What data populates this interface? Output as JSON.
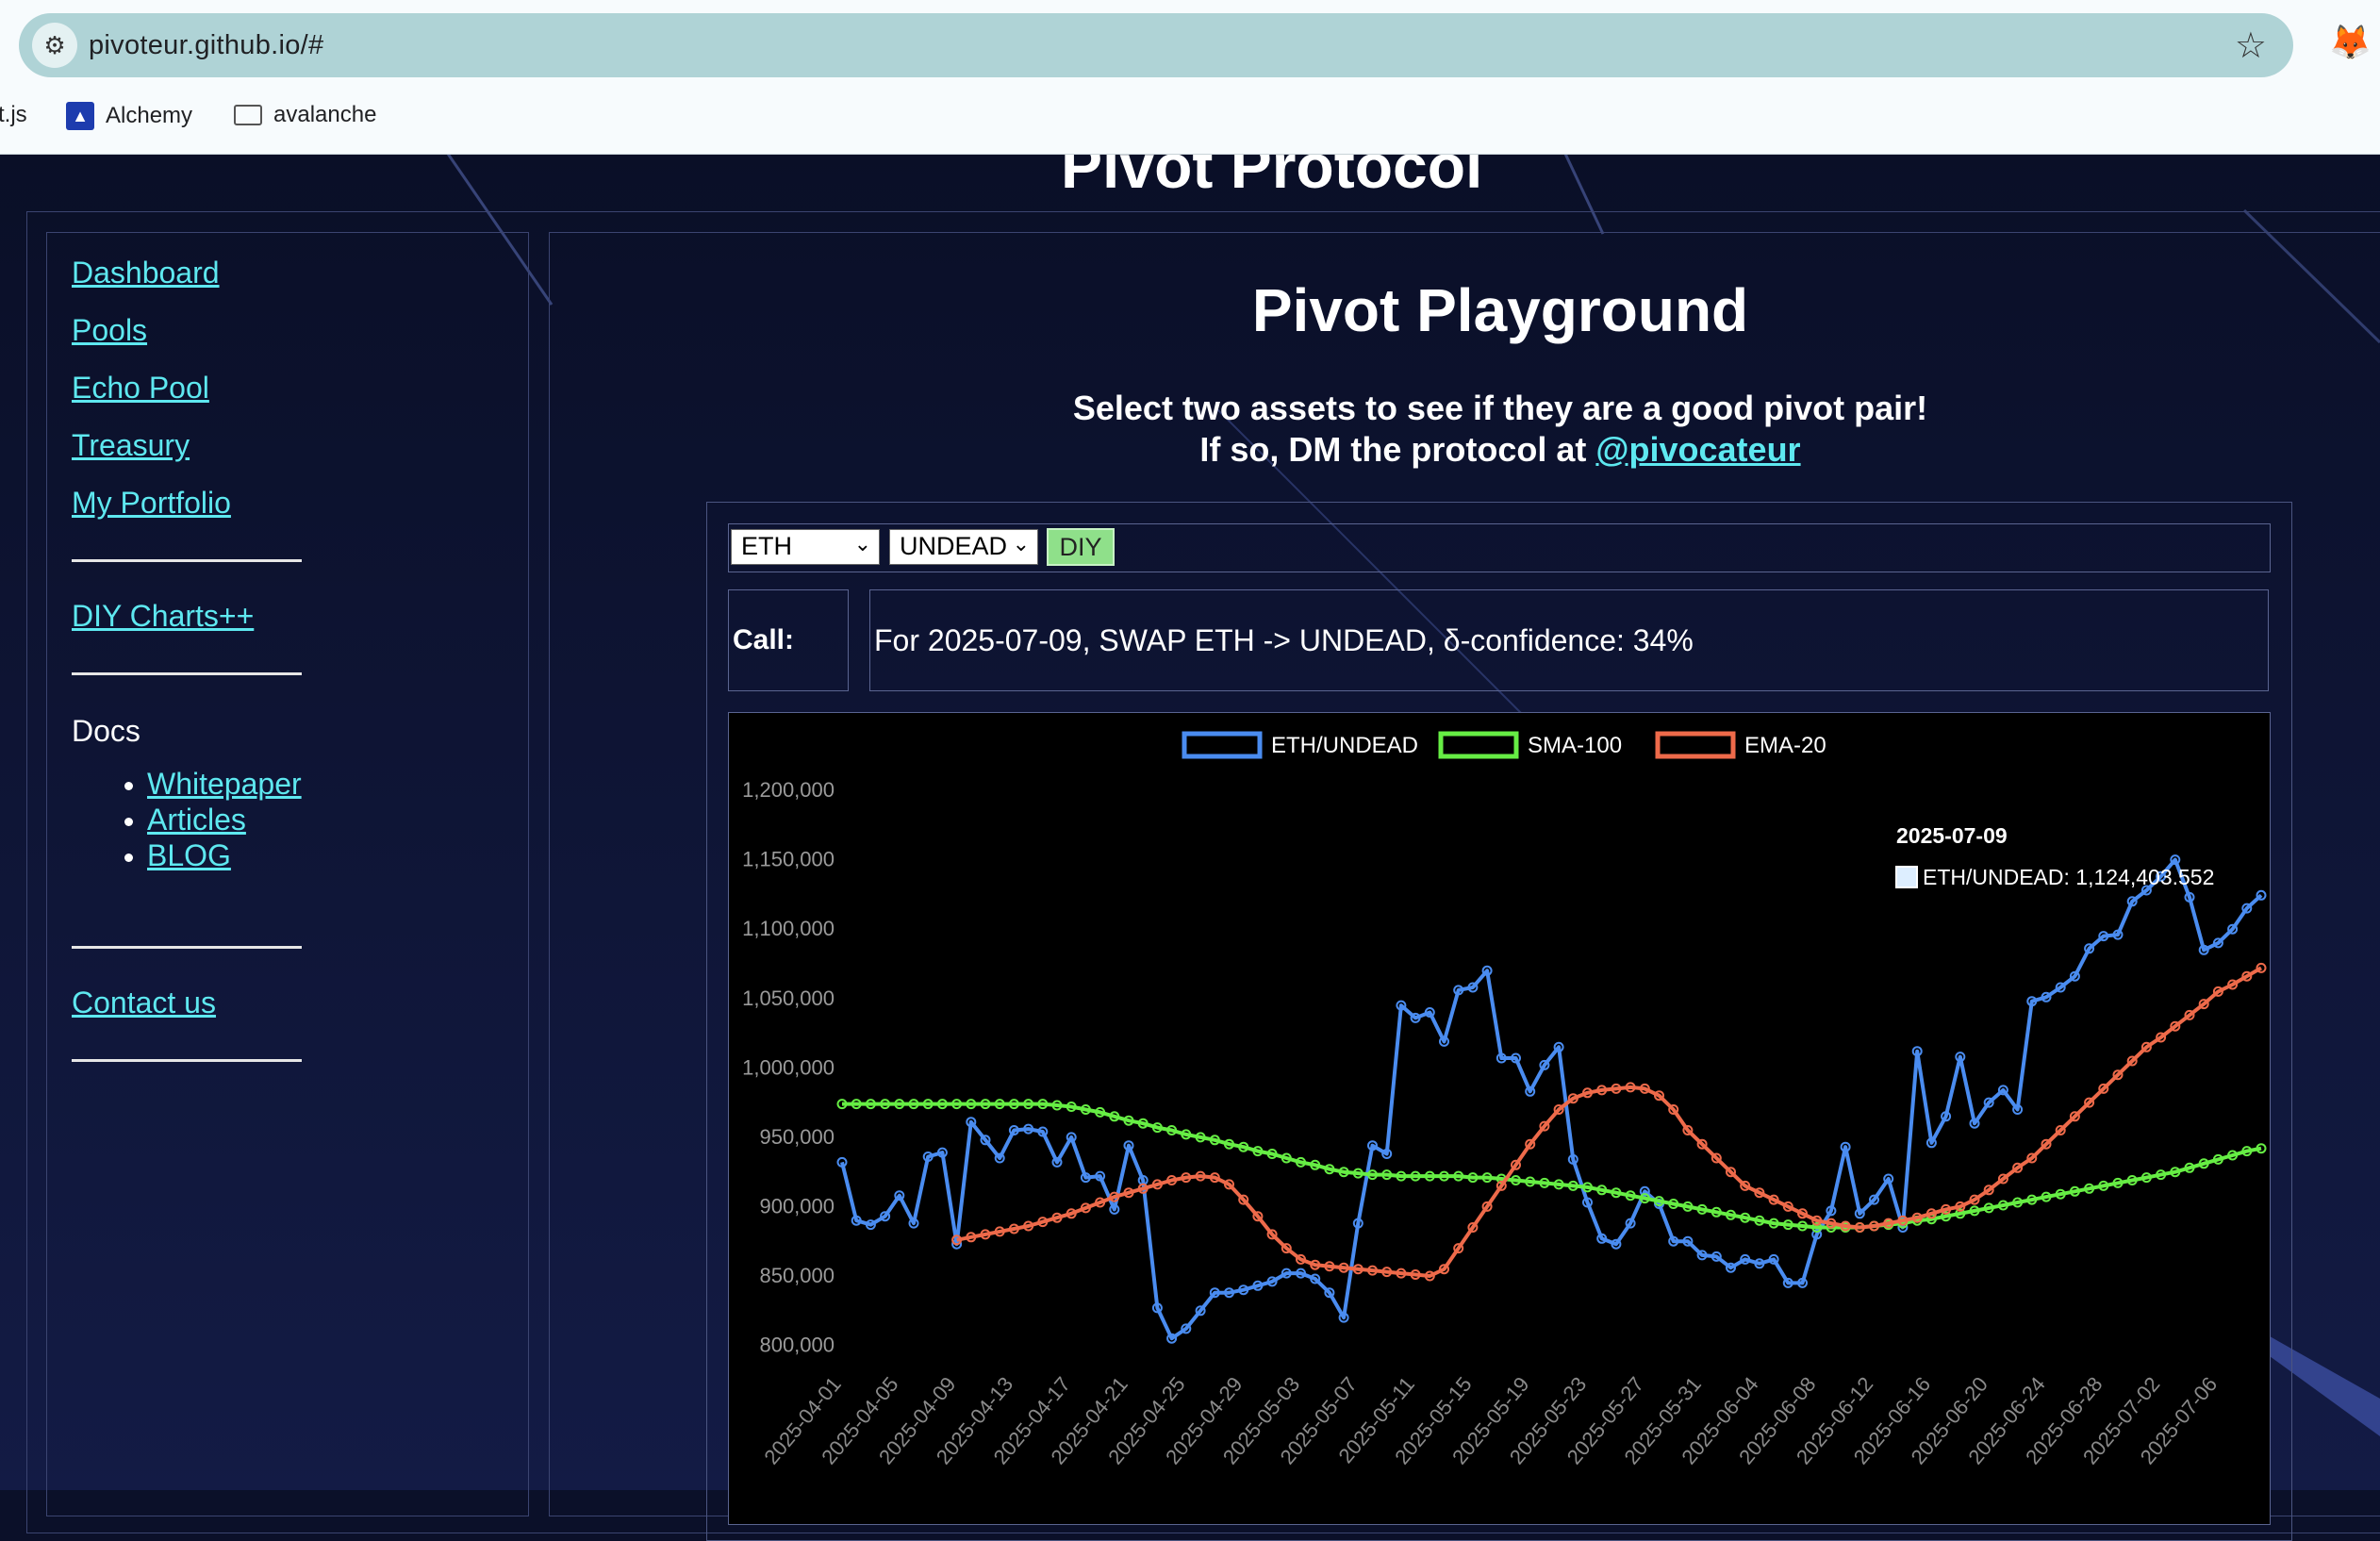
{
  "browser": {
    "url": "pivoteur.github.io/#",
    "bookmarks": [
      {
        "label": "t.js",
        "icon": "none"
      },
      {
        "label": "Alchemy",
        "icon": "alchemy-icon"
      },
      {
        "label": "avalanche",
        "icon": "folder-icon"
      }
    ]
  },
  "header": {
    "site_title": "Pivot Protocol"
  },
  "sidebar": {
    "links": [
      "Dashboard",
      "Pools",
      "Echo Pool",
      "Treasury",
      "My Portfolio"
    ],
    "diy_link": "DIY Charts++",
    "docs_heading": "Docs",
    "docs_links": [
      "Whitepaper",
      "Articles",
      "BLOG"
    ],
    "contact_link": "Contact us"
  },
  "main": {
    "title": "Pivot Playground",
    "subtitle_line1": "Select two assets to see if they are a good pivot pair!",
    "subtitle_line2_prefix": "If so, DM the protocol at ",
    "subtitle_handle": "@pivocateur",
    "asset_a": "ETH",
    "asset_b": "UNDEAD",
    "diy_button": "DIY",
    "call_label": "Call:",
    "call_text": "For 2025-07-09, SWAP ETH -> UNDEAD, δ-confidence: 34%"
  },
  "colors": {
    "series_pair": "#4a8cf0",
    "series_sma": "#66ee44",
    "series_ema": "#ee6a4a",
    "link": "#5ee8f0",
    "diy_button": "#8fe08a"
  },
  "chart_data": {
    "type": "line",
    "ylim": [
      780000,
      1215000
    ],
    "y_ticks": [
      "800,000",
      "850,000",
      "900,000",
      "950,000",
      "1,000,000",
      "1,050,000",
      "1,100,000",
      "1,150,000",
      "1,200,000"
    ],
    "x_tick_labels": [
      "2025-04-01",
      "2025-04-05",
      "2025-04-09",
      "2025-04-13",
      "2025-04-17",
      "2025-04-21",
      "2025-04-25",
      "2025-04-29",
      "2025-05-03",
      "2025-05-07",
      "2025-05-11",
      "2025-05-15",
      "2025-05-19",
      "2025-05-23",
      "2025-05-27",
      "2025-05-31",
      "2025-06-04",
      "2025-06-08",
      "2025-06-12",
      "2025-06-16",
      "2025-06-20",
      "2025-06-24",
      "2025-06-28",
      "2025-07-02",
      "2025-07-06"
    ],
    "x_start": "2025-04-01",
    "x_end": "2025-07-09",
    "legend_position": "top",
    "tooltip": {
      "title": "2025-07-09",
      "label": "ETH/UNDEAD: 1,124,403.552"
    },
    "series": [
      {
        "name": "ETH/UNDEAD",
        "color": "#4a8cf0",
        "values": [
          932000,
          890000,
          887000,
          893000,
          908000,
          888000,
          936000,
          939000,
          873000,
          961000,
          948000,
          935000,
          955000,
          956000,
          954000,
          932000,
          950000,
          921000,
          922000,
          898000,
          944000,
          919000,
          827000,
          805000,
          812000,
          825000,
          838000,
          838000,
          840000,
          843000,
          846000,
          852000,
          852000,
          848000,
          838000,
          820000,
          888000,
          944000,
          938000,
          1045000,
          1036000,
          1040000,
          1019000,
          1056000,
          1058000,
          1070000,
          1007000,
          1007000,
          983000,
          1002000,
          1015000,
          934000,
          903000,
          877000,
          873000,
          888000,
          911000,
          902000,
          875000,
          875000,
          865000,
          864000,
          856000,
          862000,
          859000,
          862000,
          845000,
          845000,
          880000,
          897000,
          943000,
          895000,
          905000,
          920000,
          885000,
          1012000,
          946000,
          965000,
          1008000,
          960000,
          975000,
          984000,
          970000,
          1048000,
          1051000,
          1058000,
          1066000,
          1086000,
          1095000,
          1096000,
          1120000,
          1128000,
          1138000,
          1150000,
          1123000,
          1085000,
          1090000,
          1100000,
          1115000,
          1124404
        ]
      },
      {
        "name": "SMA-100",
        "color": "#66ee44",
        "values": [
          974000,
          974000,
          974000,
          974000,
          974000,
          974000,
          974000,
          974000,
          974000,
          974000,
          974000,
          974000,
          974000,
          974000,
          974000,
          973000,
          972000,
          970000,
          968000,
          965000,
          962000,
          960000,
          957000,
          955000,
          952000,
          950000,
          948000,
          945000,
          943000,
          940000,
          938000,
          935000,
          932000,
          930000,
          927000,
          925000,
          924000,
          923000,
          923000,
          922000,
          922000,
          922000,
          922000,
          922000,
          921000,
          921000,
          920000,
          919000,
          918000,
          917000,
          916000,
          915000,
          914000,
          912000,
          910000,
          908000,
          906000,
          904000,
          902000,
          900000,
          898000,
          896000,
          894000,
          892000,
          890000,
          888000,
          887000,
          886000,
          885000,
          885000,
          885000,
          885000,
          886000,
          887000,
          888000,
          890000,
          891000,
          893000,
          895000,
          897000,
          899000,
          901000,
          903000,
          905000,
          907000,
          909000,
          911000,
          913000,
          915000,
          917000,
          919000,
          921000,
          923000,
          925000,
          928000,
          931000,
          934000,
          937000,
          940000,
          942000
        ]
      },
      {
        "name": "EMA-20",
        "color": "#ee6a4a",
        "values": [
          876000,
          878000,
          880000,
          882000,
          884000,
          886000,
          889000,
          892000,
          895000,
          899000,
          903000,
          907000,
          910000,
          913000,
          916000,
          919000,
          921000,
          922000,
          921000,
          916000,
          905000,
          893000,
          880000,
          870000,
          862000,
          858000,
          857000,
          856000,
          855000,
          854000,
          853000,
          852000,
          851000,
          850000,
          855000,
          870000,
          885000,
          900000,
          915000,
          930000,
          945000,
          958000,
          970000,
          978000,
          982000,
          984000,
          985000,
          986000,
          985000,
          980000,
          970000,
          955000,
          945000,
          935000,
          925000,
          915000,
          910000,
          905000,
          900000,
          895000,
          890000,
          888000,
          886000,
          885000,
          886000,
          888000,
          890000,
          892000,
          895000,
          898000,
          900000,
          905000,
          912000,
          920000,
          928000,
          935000,
          945000,
          955000,
          965000,
          975000,
          985000,
          995000,
          1005000,
          1015000,
          1022000,
          1030000,
          1038000,
          1046000,
          1055000,
          1060000,
          1066000,
          1072000
        ]
      }
    ]
  }
}
